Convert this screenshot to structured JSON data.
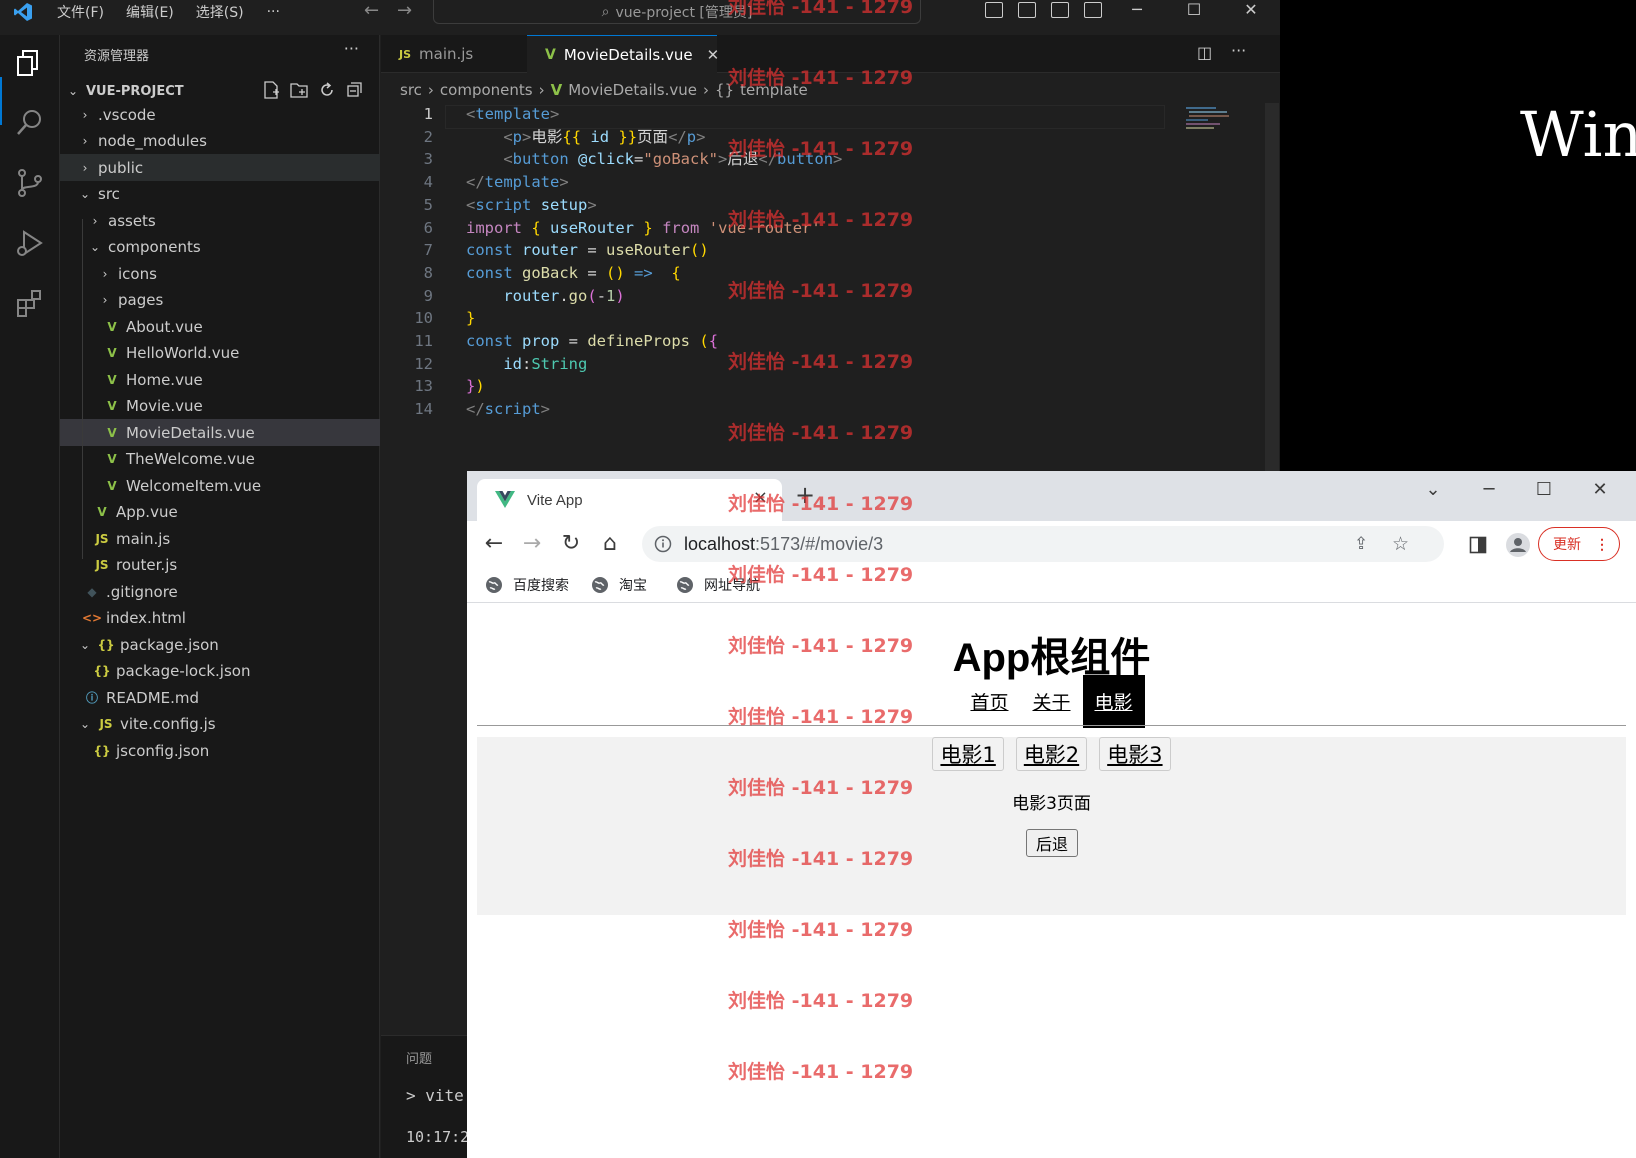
{
  "vscode": {
    "menu": [
      "文件(F)",
      "编辑(E)",
      "选择(S)"
    ],
    "menu_more": "···",
    "command_center": "vue-project [管理员]",
    "sidebar": {
      "title": "资源管理器",
      "more": "···",
      "project_name": "VUE-PROJECT",
      "tree": [
        {
          "label": ".vscode",
          "kind": "folder",
          "expanded": false,
          "depth": 1
        },
        {
          "label": "node_modules",
          "kind": "folder",
          "expanded": false,
          "depth": 1
        },
        {
          "label": "public",
          "kind": "folder",
          "expanded": false,
          "depth": 1
        },
        {
          "label": "src",
          "kind": "folder",
          "expanded": true,
          "depth": 1
        },
        {
          "label": "assets",
          "kind": "folder",
          "expanded": false,
          "depth": 2
        },
        {
          "label": "components",
          "kind": "folder",
          "expanded": true,
          "depth": 2
        },
        {
          "label": "icons",
          "kind": "folder",
          "expanded": false,
          "depth": 3
        },
        {
          "label": "pages",
          "kind": "folder",
          "expanded": false,
          "depth": 3
        },
        {
          "label": "About.vue",
          "kind": "vue",
          "depth": 3
        },
        {
          "label": "HelloWorld.vue",
          "kind": "vue",
          "depth": 3
        },
        {
          "label": "Home.vue",
          "kind": "vue",
          "depth": 3
        },
        {
          "label": "Movie.vue",
          "kind": "vue",
          "depth": 3
        },
        {
          "label": "MovieDetails.vue",
          "kind": "vue",
          "depth": 3
        },
        {
          "label": "TheWelcome.vue",
          "kind": "vue",
          "depth": 3
        },
        {
          "label": "WelcomeItem.vue",
          "kind": "vue",
          "depth": 3
        },
        {
          "label": "App.vue",
          "kind": "vue",
          "depth": 2
        },
        {
          "label": "main.js",
          "kind": "js",
          "depth": 2
        },
        {
          "label": "router.js",
          "kind": "js",
          "depth": 2
        },
        {
          "label": ".gitignore",
          "kind": "git",
          "depth": 1
        },
        {
          "label": "index.html",
          "kind": "html",
          "depth": 1
        },
        {
          "label": "package.json",
          "kind": "json",
          "expanded": true,
          "depth": 1
        },
        {
          "label": "package-lock.json",
          "kind": "json",
          "depth": 2
        },
        {
          "label": "README.md",
          "kind": "info",
          "depth": 1
        },
        {
          "label": "vite.config.js",
          "kind": "js",
          "expanded": true,
          "depth": 1
        },
        {
          "label": "jsconfig.json",
          "kind": "json",
          "depth": 2
        }
      ]
    },
    "tabs": [
      {
        "label": "main.js",
        "icon": "JS",
        "active": false
      },
      {
        "label": "MovieDetails.vue",
        "icon": "V",
        "active": true
      }
    ],
    "breadcrumb": [
      "src",
      "components",
      "MovieDetails.vue",
      "template"
    ],
    "current_line": 1,
    "code_lines": [
      [
        [
          "tk-ang",
          "<"
        ],
        [
          "tk-tag",
          "template"
        ],
        [
          "tk-ang",
          ">"
        ]
      ],
      [
        [
          "tk-txt",
          "    "
        ],
        [
          "tk-ang",
          "<"
        ],
        [
          "tk-tag",
          "p"
        ],
        [
          "tk-ang",
          ">"
        ],
        [
          "tk-txt",
          "电影"
        ],
        [
          "tk-brace",
          "{{"
        ],
        [
          "tk-var",
          " id "
        ],
        [
          "tk-brace",
          "}}"
        ],
        [
          "tk-txt",
          "页面"
        ],
        [
          "tk-ang",
          "</"
        ],
        [
          "tk-tag",
          "p"
        ],
        [
          "tk-ang",
          ">"
        ]
      ],
      [
        [
          "tk-txt",
          "    "
        ],
        [
          "tk-ang",
          "<"
        ],
        [
          "tk-tag",
          "button"
        ],
        [
          "tk-txt",
          " "
        ],
        [
          "tk-var",
          "@click"
        ],
        [
          "tk-txt",
          "="
        ],
        [
          "tk-str",
          "\"goBack\""
        ],
        [
          "tk-ang",
          ">"
        ],
        [
          "tk-txt",
          "后退"
        ],
        [
          "tk-ang",
          "</"
        ],
        [
          "tk-tag",
          "button"
        ],
        [
          "tk-ang",
          ">"
        ]
      ],
      [
        [
          "tk-ang",
          "</"
        ],
        [
          "tk-tag",
          "template"
        ],
        [
          "tk-ang",
          ">"
        ]
      ],
      [
        [
          "tk-ang",
          "<"
        ],
        [
          "tk-tag",
          "script"
        ],
        [
          "tk-txt",
          " "
        ],
        [
          "tk-var",
          "setup"
        ],
        [
          "tk-ang",
          ">"
        ]
      ],
      [
        [
          "tk-kw",
          "import"
        ],
        [
          "tk-txt",
          " "
        ],
        [
          "tk-brace",
          "{"
        ],
        [
          "tk-txt",
          " "
        ],
        [
          "tk-var",
          "useRouter"
        ],
        [
          "tk-txt",
          " "
        ],
        [
          "tk-brace",
          "}"
        ],
        [
          "tk-txt",
          " "
        ],
        [
          "tk-kw",
          "from"
        ],
        [
          "tk-txt",
          " "
        ],
        [
          "tk-str",
          "'vue-router'"
        ]
      ],
      [
        [
          "tk-decl",
          "const"
        ],
        [
          "tk-txt",
          " "
        ],
        [
          "tk-var",
          "router"
        ],
        [
          "tk-txt",
          " = "
        ],
        [
          "tk-fn",
          "useRouter"
        ],
        [
          "tk-brace",
          "()"
        ]
      ],
      [
        [
          "tk-decl",
          "const"
        ],
        [
          "tk-txt",
          " "
        ],
        [
          "tk-fn",
          "goBack"
        ],
        [
          "tk-txt",
          " = "
        ],
        [
          "tk-brace",
          "()"
        ],
        [
          "tk-txt",
          " "
        ],
        [
          "tk-decl",
          "=>"
        ],
        [
          "tk-txt",
          "  "
        ],
        [
          "tk-brace",
          "{"
        ]
      ],
      [
        [
          "tk-txt",
          "    "
        ],
        [
          "tk-var",
          "router"
        ],
        [
          "tk-txt",
          "."
        ],
        [
          "tk-fn",
          "go"
        ],
        [
          "tk-paren",
          "("
        ],
        [
          "tk-txt",
          "-"
        ],
        [
          "tk-num",
          "1"
        ],
        [
          "tk-paren",
          ")"
        ]
      ],
      [
        [
          "tk-brace",
          "}"
        ]
      ],
      [
        [
          "tk-decl",
          "const"
        ],
        [
          "tk-txt",
          " "
        ],
        [
          "tk-var",
          "prop"
        ],
        [
          "tk-txt",
          " = "
        ],
        [
          "tk-fn",
          "defineProps"
        ],
        [
          "tk-txt",
          " "
        ],
        [
          "tk-brace",
          "("
        ],
        [
          "tk-paren",
          "{"
        ]
      ],
      [
        [
          "tk-txt",
          "    "
        ],
        [
          "tk-var",
          "id"
        ],
        [
          "tk-txt",
          ":"
        ],
        [
          "tk-type",
          "String"
        ]
      ],
      [
        [
          "tk-paren",
          "}"
        ],
        [
          "tk-brace",
          ")"
        ]
      ],
      [
        [
          "tk-ang",
          "</"
        ],
        [
          "tk-tag",
          "script"
        ],
        [
          "tk-ang",
          ">"
        ]
      ]
    ],
    "panel": {
      "tab": "问题",
      "cmd": "> vite",
      "time": "10:17:2"
    }
  },
  "desktop_text": "Win",
  "chrome": {
    "tab_title": "Vite App",
    "tab_close": "×",
    "new_tab": "+",
    "url_host": "localhost",
    "url_path": ":5173/#/movie/3",
    "update_label": "更新",
    "bookmarks": [
      "百度搜索",
      "淘宝",
      "网址导航"
    ],
    "page": {
      "title": "App根组件",
      "nav": [
        {
          "label": "首页",
          "active": false
        },
        {
          "label": "关于",
          "active": false
        },
        {
          "label": "电影",
          "active": true
        }
      ],
      "movie_links": [
        "电影1",
        "电影2",
        "电影3"
      ],
      "movie_text": "电影3页面",
      "back_button": "后退"
    }
  },
  "watermark": {
    "text": "刘佳怡 -141 - 1279",
    "count": 16,
    "color": "#e13232"
  }
}
